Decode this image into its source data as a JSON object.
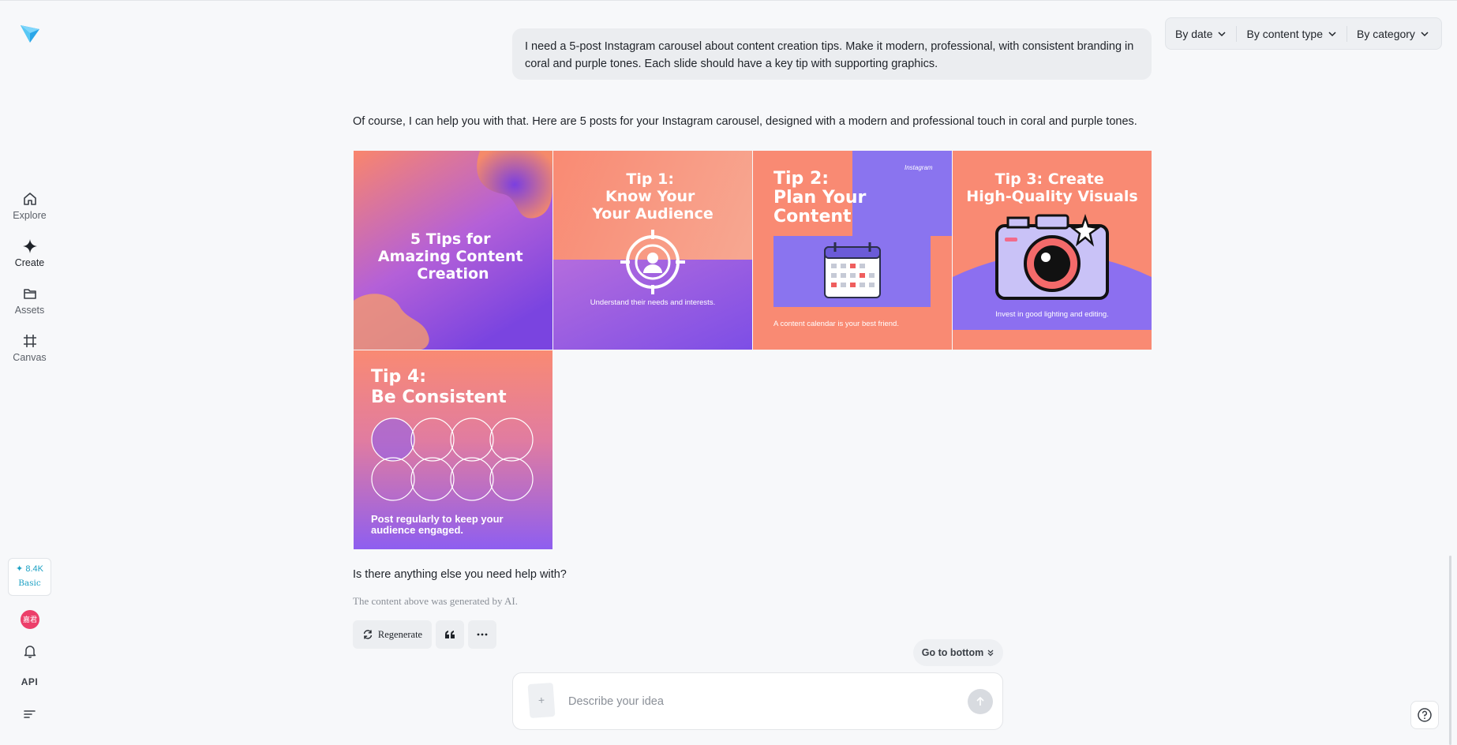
{
  "sidebar": {
    "items": [
      {
        "label": "Explore",
        "icon": "home-icon"
      },
      {
        "label": "Create",
        "icon": "sparkle-icon"
      },
      {
        "label": "Assets",
        "icon": "folder-icon"
      },
      {
        "label": "Canvas",
        "icon": "crop-icon"
      }
    ],
    "credits": {
      "value": "✦ 8.4K",
      "tier": "Basic"
    },
    "avatar_text": "嘉君",
    "api_label": "API"
  },
  "filters": [
    {
      "label": "By date"
    },
    {
      "label": "By content type"
    },
    {
      "label": "By category"
    }
  ],
  "conversation": {
    "user_message": "I need a 5-post Instagram carousel about content creation tips. Make it modern, professional, with consistent branding in coral and purple tones. Each slide should have a key tip with supporting graphics.",
    "assistant_reply": "Of course, I can help you with that. Here are 5 posts for your Instagram carousel, designed with a modern and professional touch in coral and purple tones.",
    "images": [
      {
        "title_lines": [
          "5 Tips for",
          "Amazing Content",
          "Creation"
        ],
        "caption": ""
      },
      {
        "title_lines": [
          "Tip 1:",
          "Know Your",
          "Your Audience"
        ],
        "caption": "Understand their needs and interests."
      },
      {
        "title_lines": [
          "Tip 2:",
          "Plan Your",
          "Content"
        ],
        "caption": "A content calendar is your best friend.",
        "brand": "Instagram"
      },
      {
        "title_lines": [
          "Tip 3: Create",
          "High-Quality Visuals"
        ],
        "caption": "Invest in good lighting and editing."
      },
      {
        "title_lines": [
          "Tip 4:",
          "Be Consistent"
        ],
        "caption_lines": [
          "Post regularly to keep your",
          "audience engaged."
        ]
      }
    ],
    "followup": "Is there anything else you need help with?",
    "disclaimer": "The content above was generated by AI.",
    "actions": {
      "regenerate": "Regenerate"
    }
  },
  "go_bottom_label": "Go to bottom",
  "composer": {
    "placeholder": "Describe your idea",
    "attach_symbol": "+"
  },
  "colors": {
    "coral": "#f98a73",
    "purple": "#8a5cf0",
    "accent_cyan": "#1da1c4",
    "avatar": "#ec3f6a"
  }
}
